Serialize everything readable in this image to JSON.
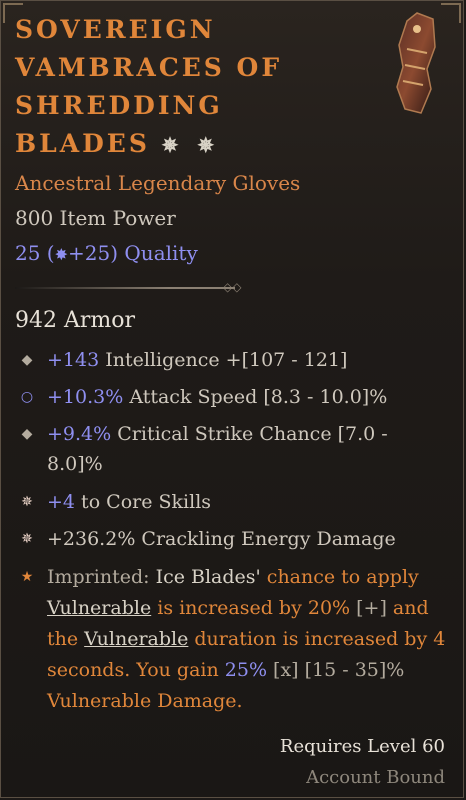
{
  "item": {
    "title": "Sovereign Vambraces of Shredding Blades",
    "title_stars": "✵ ✵",
    "subtitle": "Ancestral Legendary Gloves",
    "item_power": "800 Item Power",
    "quality": {
      "base": "25",
      "open": " (",
      "bonus": "+25",
      "close": ") Quality"
    },
    "armor": "942 Armor"
  },
  "affixes": [
    {
      "bullet": "◆",
      "value": "+143",
      "text": " Intelligence +[107 - 121]"
    },
    {
      "bullet": "○",
      "value": "+10.3%",
      "text": " Attack Speed [8.3 - 10.0]%"
    },
    {
      "bullet": "◆",
      "value": "+9.4%",
      "text": " Critical Strike Chance [7.0 - 8.0]%"
    },
    {
      "bullet": "✵",
      "value": "+4",
      "text": " to Core Skills"
    },
    {
      "bullet": "✵",
      "value": "+236.2%",
      "text": " Crackling Energy Damage"
    }
  ],
  "imprint": {
    "bullet": "★",
    "prefix": "Imprinted: ",
    "skill": "Ice Blades'",
    "part1": " chance to apply ",
    "vuln1": "Vulnerable",
    "part2": " is increased by 20% ",
    "plus": "[+]",
    "part3": " and the ",
    "vuln2": "Vulnerable",
    "part4": " duration is increased by 4 seconds. You gain ",
    "gain": "25%",
    "x": "[x]",
    "range": " [15 - 35]%",
    "part5": " Vulnerable Damage."
  },
  "footer": {
    "requires": "Requires Level 60",
    "bound": "Account Bound"
  },
  "colors": {
    "legendary": "#e0863a",
    "magic": "#8f8ff0",
    "text": "#cfc8bd"
  }
}
